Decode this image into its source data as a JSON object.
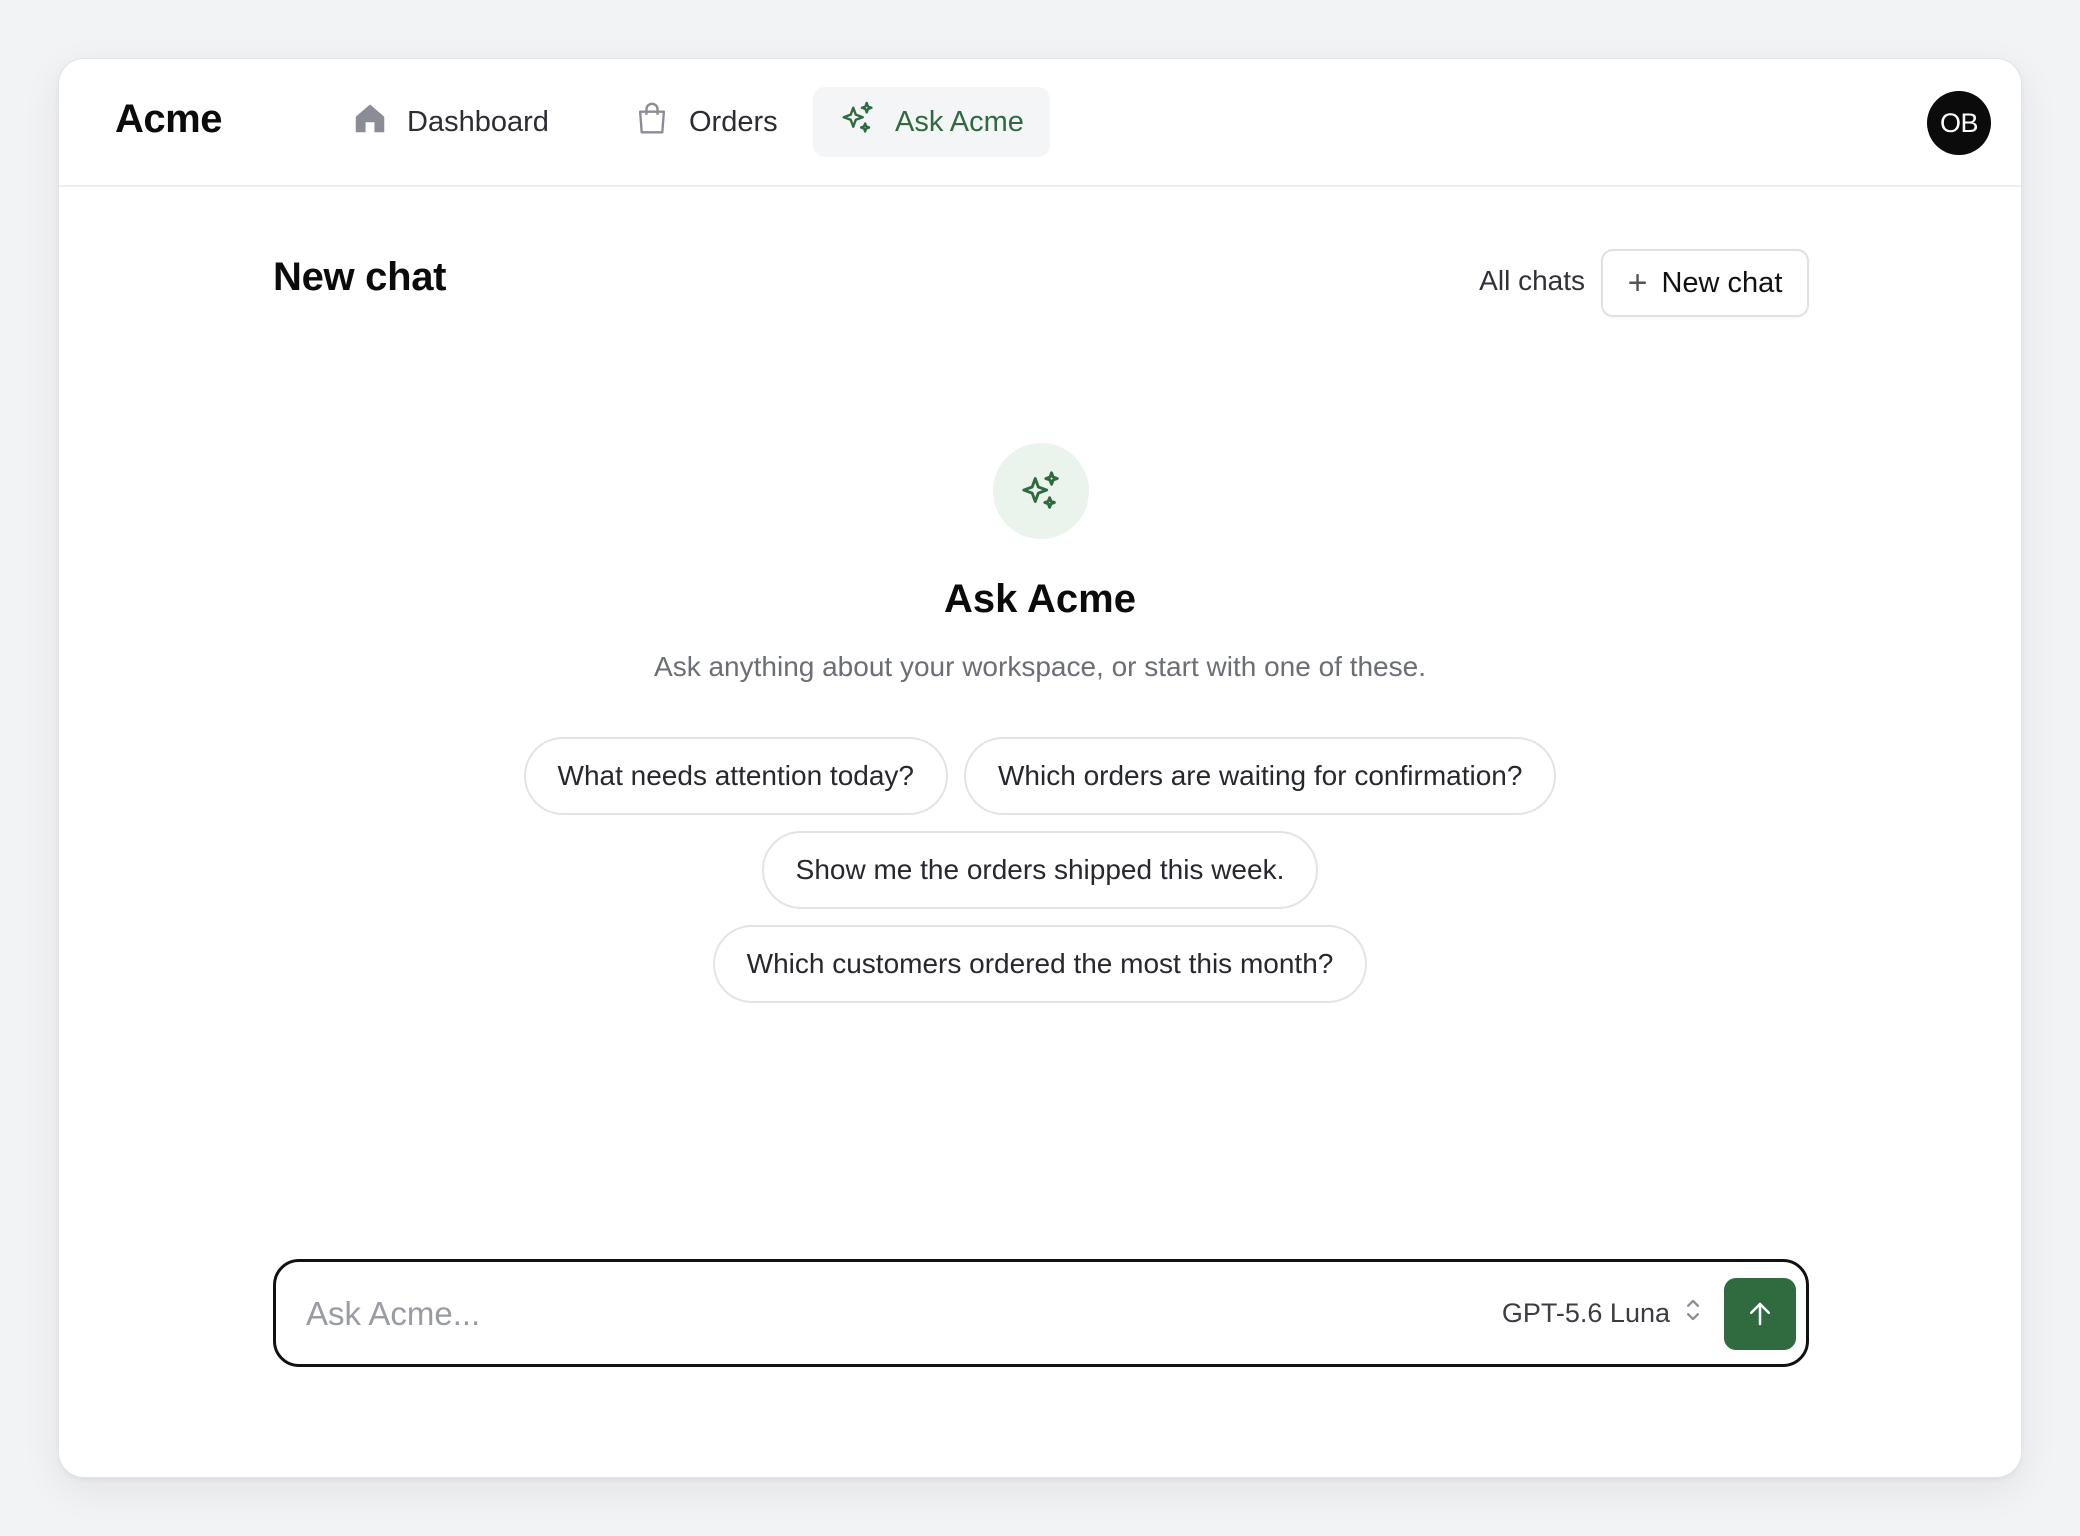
{
  "brand": "Acme",
  "nav": {
    "dashboard": "Dashboard",
    "orders": "Orders",
    "ask": "Ask Acme"
  },
  "user": {
    "initials": "OB"
  },
  "header": {
    "title": "New chat",
    "all_chats": "All chats",
    "new_chat": "New chat"
  },
  "hero": {
    "title": "Ask Acme",
    "subtitle": "Ask anything about your workspace, or start with one of these."
  },
  "suggestions": [
    "What needs attention today?",
    "Which orders are waiting for confirmation?",
    "Show me the orders shipped this week.",
    "Which customers ordered the most this month?"
  ],
  "composer": {
    "placeholder": "Ask Acme...",
    "model": "GPT-5.6 Luna"
  },
  "colors": {
    "accent": "#2f6b3f",
    "accent_bg": "#eaf3ec"
  },
  "icons": {
    "dashboard": "home-icon",
    "orders": "shopping-bag-icon",
    "ask": "sparkles-icon",
    "model": "chevron-up-down-icon",
    "send": "arrow-up-icon"
  }
}
